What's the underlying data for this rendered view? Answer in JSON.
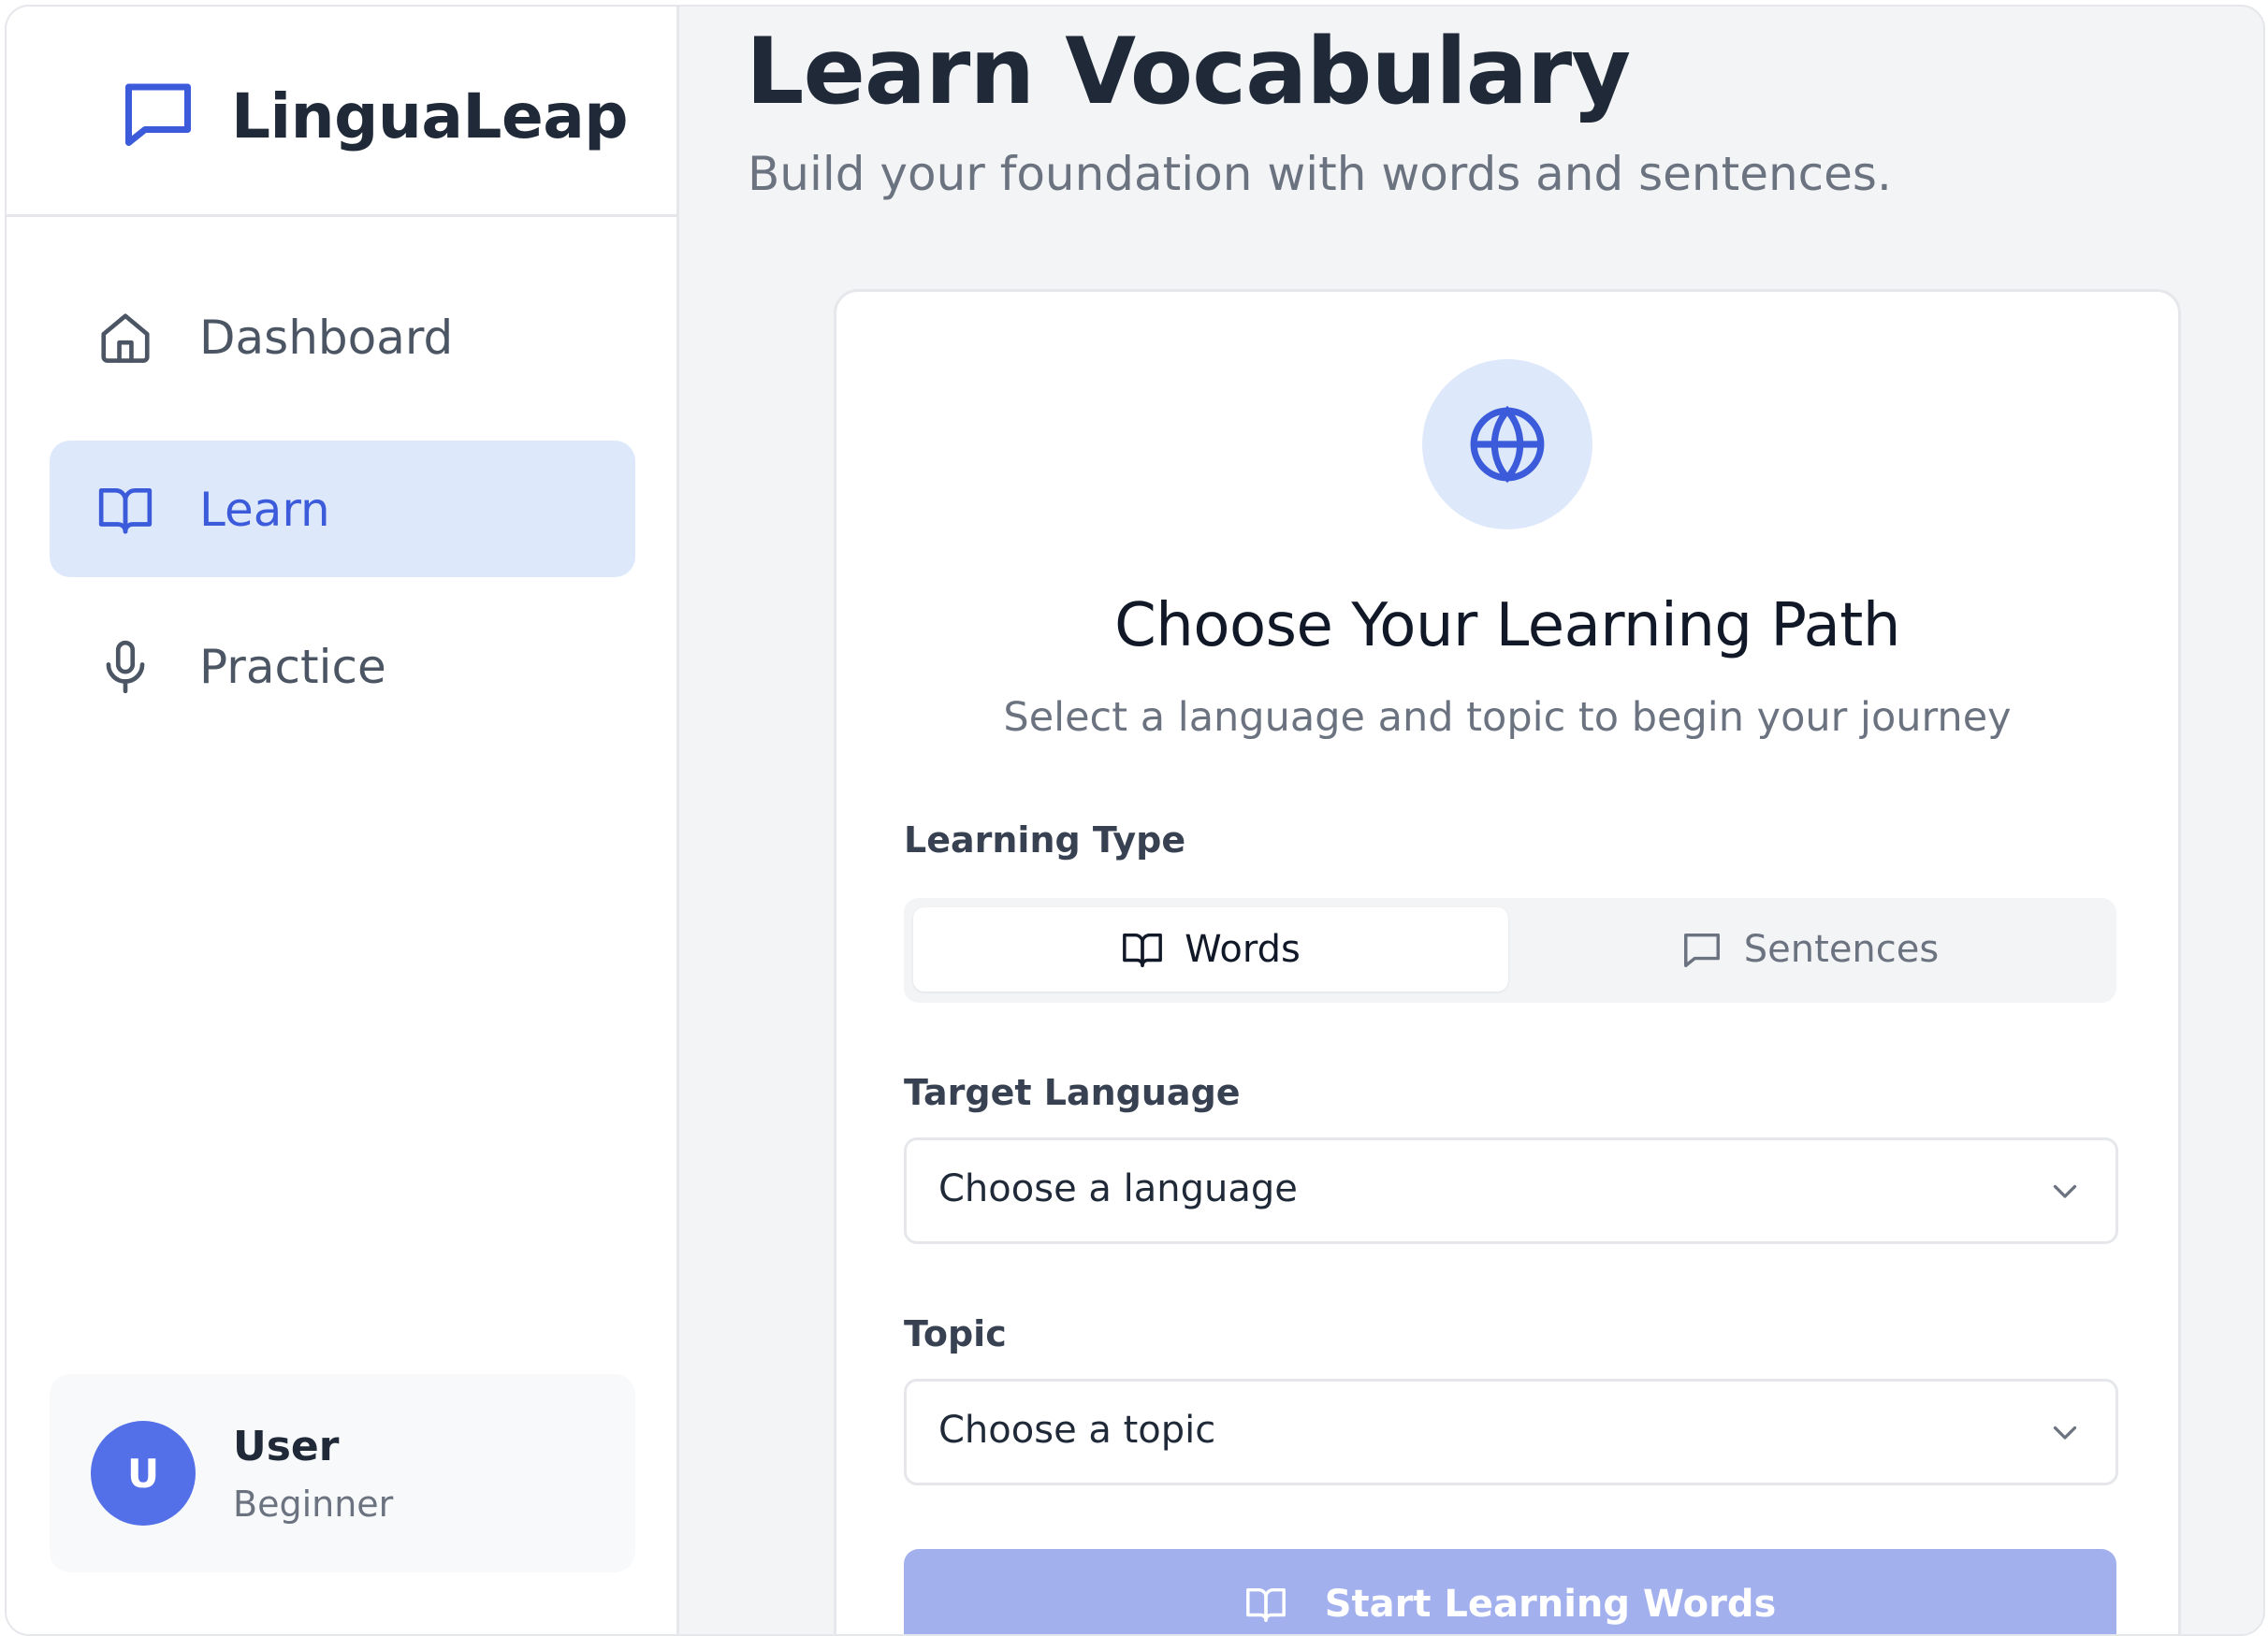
{
  "app": {
    "name": "LinguaLeap",
    "brand_icon": "chat-bubble-icon",
    "accent_color": "#3b5bdb"
  },
  "sidebar": {
    "items": [
      {
        "label": "Dashboard",
        "icon": "home-icon",
        "active": false
      },
      {
        "label": "Learn",
        "icon": "book-open-icon",
        "active": true
      },
      {
        "label": "Practice",
        "icon": "microphone-icon",
        "active": false
      }
    ]
  },
  "user": {
    "initial": "U",
    "name": "User",
    "level": "Beginner"
  },
  "main": {
    "title": "Learn Vocabulary",
    "subtitle": "Build your foundation with words and sentences."
  },
  "card": {
    "icon": "globe-icon",
    "title": "Choose Your Learning Path",
    "subtitle": "Select a language and topic to begin your journey",
    "learning_type": {
      "label": "Learning Type",
      "options": [
        {
          "label": "Words",
          "icon": "book-open-icon",
          "selected": true
        },
        {
          "label": "Sentences",
          "icon": "chat-bubble-icon",
          "selected": false
        }
      ]
    },
    "target_language": {
      "label": "Target Language",
      "value": "Choose a language"
    },
    "topic": {
      "label": "Topic",
      "value": "Choose a topic"
    },
    "start_button": {
      "label": "Start Learning Words",
      "icon": "book-open-icon"
    }
  }
}
